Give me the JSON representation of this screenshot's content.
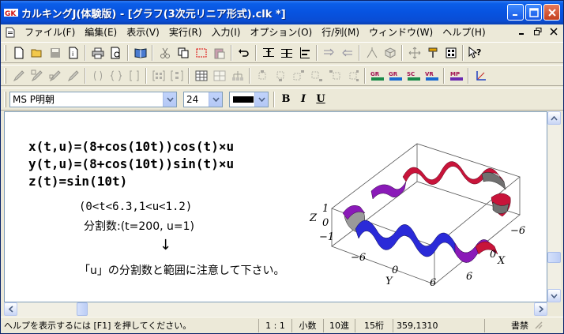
{
  "window": {
    "title": "カルキングJ(体験版) - [グラフ(3次元リニア形式).clk *]"
  },
  "menu": [
    "ファイル(F)",
    "編集(E)",
    "表示(V)",
    "実行(R)",
    "入力(I)",
    "オプション(O)",
    "行/列(M)",
    "ウィンドウ(W)",
    "ヘルプ(H)"
  ],
  "format_bar": {
    "font_name": "MS P明朝",
    "font_size": "24",
    "bold_label": "B",
    "italic_label": "I",
    "underline_label": "U"
  },
  "document": {
    "formula_x": "x(t,u)=(8+cos(10t))cos(t)×u",
    "formula_y": "y(t,u)=(8+cos(10t))sin(t)×u",
    "formula_z": "z(t)=sin(10t)",
    "range": "(0<t<6.3,1<u<1.2)",
    "divisions": "分割数:(t=200, u=1)",
    "arrow": "↓",
    "note": "「u」の分割数と範囲に注意して下さい。"
  },
  "plot": {
    "z_axis_label": "Z",
    "x_axis_label": "X",
    "y_axis_label": "Y",
    "z_ticks": [
      "1",
      "0",
      "−1"
    ],
    "y_ticks": [
      "−6",
      "0",
      "6"
    ],
    "x_ticks": [
      "−6",
      "0",
      "6"
    ]
  },
  "status": {
    "help": "ヘルプを表示するには [F1] を押してください。",
    "position": "1 : 1",
    "number_mode": "小数",
    "base": "10進",
    "digits": "15桁",
    "coords": "359,1310",
    "mode": "書禁"
  },
  "colors": {
    "titlebar": "#0753e0",
    "curve_blue": "#2a2ad8",
    "curve_red": "#c8143a",
    "curve_purple": "#8a1ab8",
    "curve_grey": "#707070"
  }
}
